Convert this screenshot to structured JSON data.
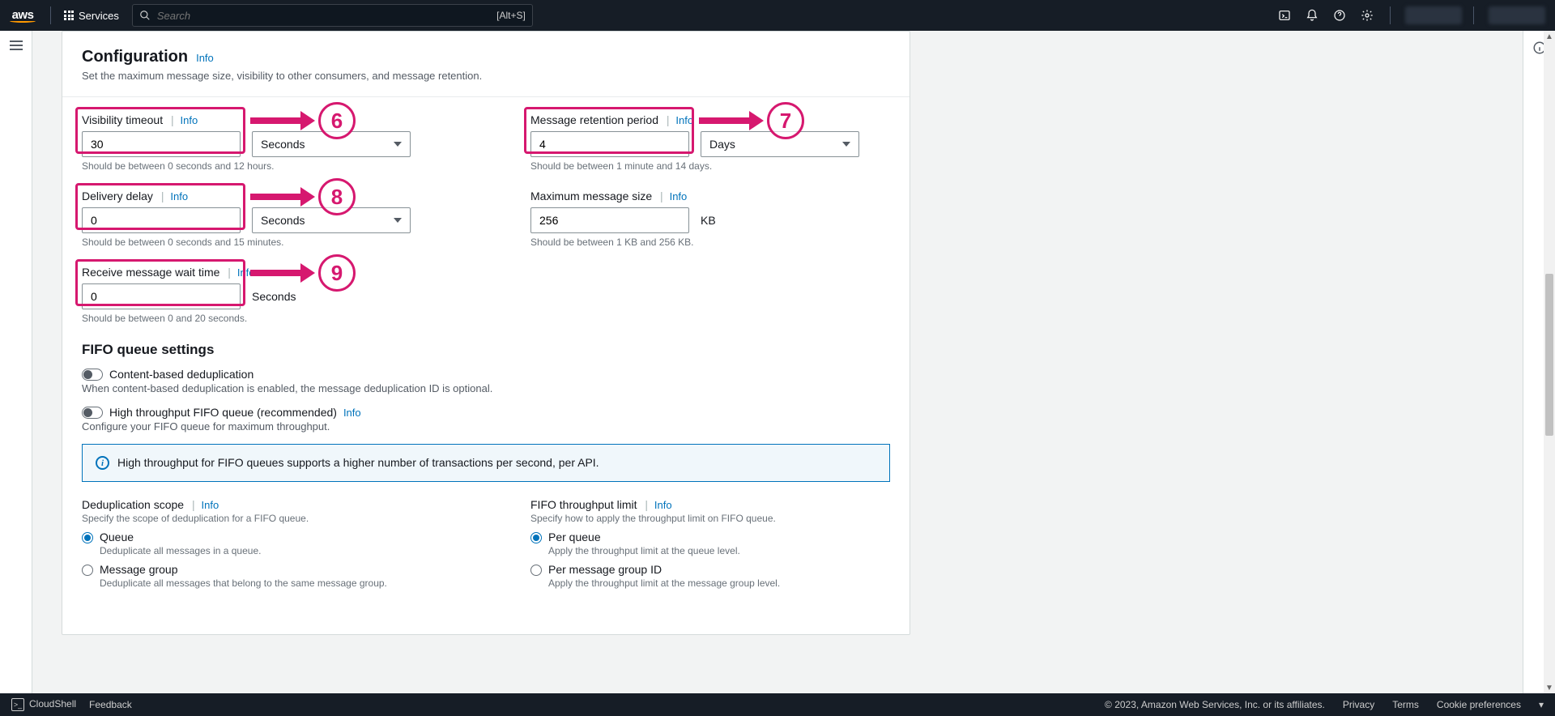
{
  "nav": {
    "services": "Services",
    "search_placeholder": "Search",
    "search_hint": "[Alt+S]"
  },
  "config": {
    "heading": "Configuration",
    "info": "Info",
    "subtitle": "Set the maximum message size, visibility to other consumers, and message retention.",
    "visibility": {
      "label": "Visibility timeout",
      "value": "30",
      "unit": "Seconds",
      "hint": "Should be between 0 seconds and 12 hours."
    },
    "retention": {
      "label": "Message retention period",
      "value": "4",
      "unit": "Days",
      "hint": "Should be between 1 minute and 14 days."
    },
    "delay": {
      "label": "Delivery delay",
      "value": "0",
      "unit": "Seconds",
      "hint": "Should be between 0 seconds and 15 minutes."
    },
    "maxsize": {
      "label": "Maximum message size",
      "value": "256",
      "unit": "KB",
      "hint": "Should be between 1 KB and 256 KB."
    },
    "wait": {
      "label": "Receive message wait time",
      "value": "0",
      "unit": "Seconds",
      "hint": "Should be between 0 and 20 seconds."
    }
  },
  "fifo": {
    "title": "FIFO queue settings",
    "dedup_label": "Content-based deduplication",
    "dedup_hint": "When content-based deduplication is enabled, the message deduplication ID is optional.",
    "high_label": "High throughput FIFO queue (recommended)",
    "high_hint": "Configure your FIFO queue for maximum throughput.",
    "banner": "High throughput for FIFO queues supports a higher number of transactions per second, per API.",
    "scope": {
      "label": "Deduplication scope",
      "sub": "Specify the scope of deduplication for a FIFO queue.",
      "opt1": "Queue",
      "opt1_hint": "Deduplicate all messages in a queue.",
      "opt2": "Message group",
      "opt2_hint": "Deduplicate all messages that belong to the same message group."
    },
    "limit": {
      "label": "FIFO throughput limit",
      "sub": "Specify how to apply the throughput limit on FIFO queue.",
      "opt1": "Per queue",
      "opt1_hint": "Apply the throughput limit at the queue level.",
      "opt2": "Per message group ID",
      "opt2_hint": "Apply the throughput limit at the message group level."
    }
  },
  "footer": {
    "cloudshell": "CloudShell",
    "feedback": "Feedback",
    "copyright": "© 2023, Amazon Web Services, Inc. or its affiliates.",
    "privacy": "Privacy",
    "terms": "Terms",
    "cookies": "Cookie preferences"
  },
  "annotations": {
    "n6": "6",
    "n7": "7",
    "n8": "8",
    "n9": "9"
  }
}
